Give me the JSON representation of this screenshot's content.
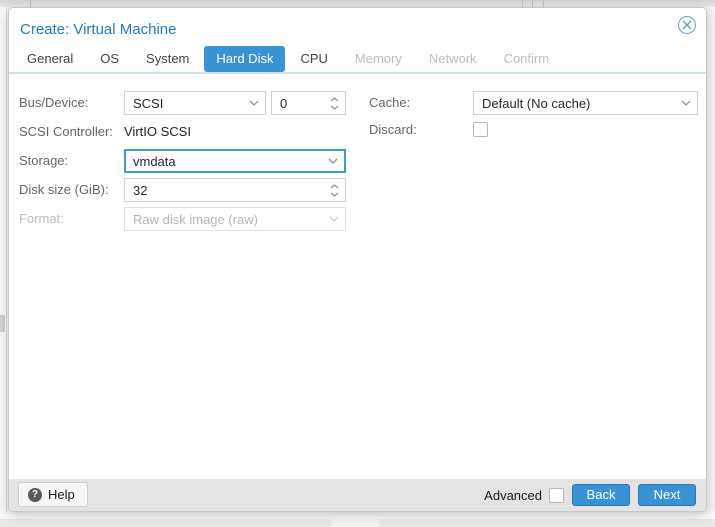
{
  "window": {
    "title": "Create: Virtual Machine"
  },
  "tabs": [
    {
      "label": "General",
      "state": "normal"
    },
    {
      "label": "OS",
      "state": "normal"
    },
    {
      "label": "System",
      "state": "normal"
    },
    {
      "label": "Hard Disk",
      "state": "active"
    },
    {
      "label": "CPU",
      "state": "normal"
    },
    {
      "label": "Memory",
      "state": "disabled"
    },
    {
      "label": "Network",
      "state": "disabled"
    },
    {
      "label": "Confirm",
      "state": "disabled"
    }
  ],
  "form": {
    "bus_device": {
      "label": "Bus/Device:",
      "value": "SCSI",
      "number": "0"
    },
    "scsi_controller": {
      "label": "SCSI Controller:",
      "value": "VirtIO SCSI"
    },
    "storage": {
      "label": "Storage:",
      "value": "vmdata",
      "focused": true
    },
    "disk_size": {
      "label": "Disk size (GiB):",
      "value": "32"
    },
    "format": {
      "label": "Format:",
      "value": "Raw disk image (raw)",
      "disabled": true
    },
    "cache": {
      "label": "Cache:",
      "value": "Default (No cache)"
    },
    "discard": {
      "label": "Discard:",
      "checked": false
    }
  },
  "footer": {
    "help": "Help",
    "advanced": "Advanced",
    "advanced_checked": false,
    "back": "Back",
    "next": "Next"
  },
  "colors": {
    "accent": "#3892d4",
    "title_text": "#1e7bbf",
    "tab_disabled_text": "#bcbcbc",
    "focus_border": "#3d9bd5",
    "footer_bg": "#e3e3e3"
  }
}
